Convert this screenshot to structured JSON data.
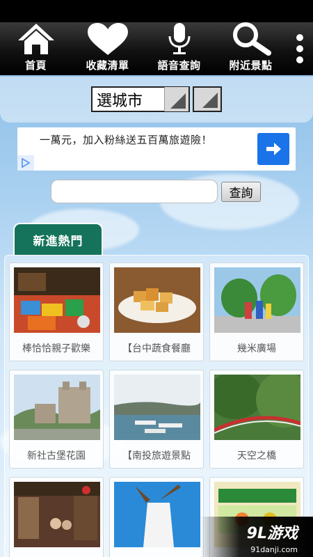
{
  "nav": {
    "items": [
      {
        "label": "首頁",
        "icon": "home-icon"
      },
      {
        "label": "收藏清單",
        "icon": "heart-icon"
      },
      {
        "label": "語音查詢",
        "icon": "microphone-icon"
      },
      {
        "label": "附近景點",
        "icon": "search-icon"
      }
    ],
    "overflow_icon": "more-vert-icon"
  },
  "city": {
    "selected": "選城市"
  },
  "ad": {
    "text": "一萬元，加入粉絲送五百萬旅遊險！",
    "arrow_icon": "arrow-right-icon",
    "choice_icon": "ad-choices-icon",
    "button_color": "#1a73e8"
  },
  "search": {
    "value": "",
    "button_label": "查詢"
  },
  "section": {
    "tab_label": "新進熱門",
    "tab_color": "#14735a"
  },
  "cards": [
    {
      "label": "棒恰恰親子歡樂"
    },
    {
      "label": "【台中蔬食餐廳"
    },
    {
      "label": "幾米廣場"
    },
    {
      "label": "新社古堡花園"
    },
    {
      "label": "【南投旅遊景點"
    },
    {
      "label": "天空之橋"
    },
    {
      "label": ""
    },
    {
      "label": ""
    },
    {
      "label": ""
    }
  ],
  "watermark": {
    "logo": "9L游戏",
    "url": "91danji.com"
  }
}
